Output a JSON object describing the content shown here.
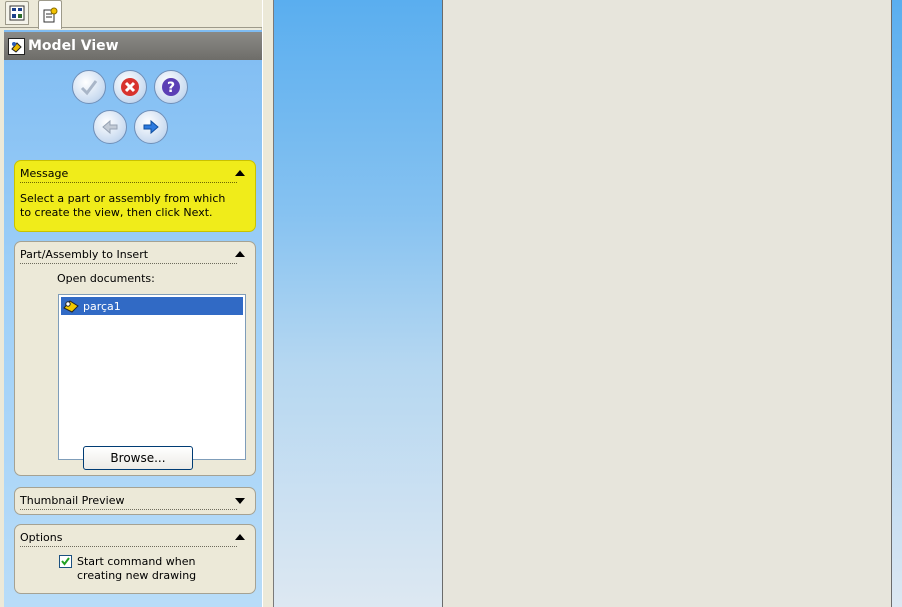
{
  "panel": {
    "title": "Model View",
    "title_icon": "model-view-icon",
    "tabs": [
      {
        "icon": "feature-manager-icon"
      },
      {
        "icon": "property-manager-icon"
      }
    ],
    "actions": [
      {
        "icon": "ok-check-icon",
        "label": "OK"
      },
      {
        "icon": "cancel-x-icon",
        "label": "Cancel"
      },
      {
        "icon": "help-question-icon",
        "label": "Help"
      },
      {
        "icon": "back-arrow-icon",
        "label": "Back"
      },
      {
        "icon": "next-arrow-icon",
        "label": "Next"
      }
    ]
  },
  "message": {
    "header": "Message",
    "text_line1": "Select a part or assembly from which",
    "text_line2": "to create the view, then click Next.",
    "color": "#f0ec1a"
  },
  "insert": {
    "header": "Part/Assembly to Insert",
    "open_docs_label": "Open documents:",
    "documents": [
      {
        "name": "parça1",
        "icon": "part-icon",
        "selected": true
      }
    ],
    "browse_label": "Browse..."
  },
  "thumbnail": {
    "header": "Thumbnail Preview",
    "collapsed": true
  },
  "options": {
    "header": "Options",
    "start_command_line1": "Start command when",
    "start_command_line2": "creating new drawing",
    "start_command_checked": true
  },
  "colors": {
    "selection": "#316ac5",
    "pane_gradient_top": "#7fbcf2",
    "sheet": "#e7e5dc"
  }
}
